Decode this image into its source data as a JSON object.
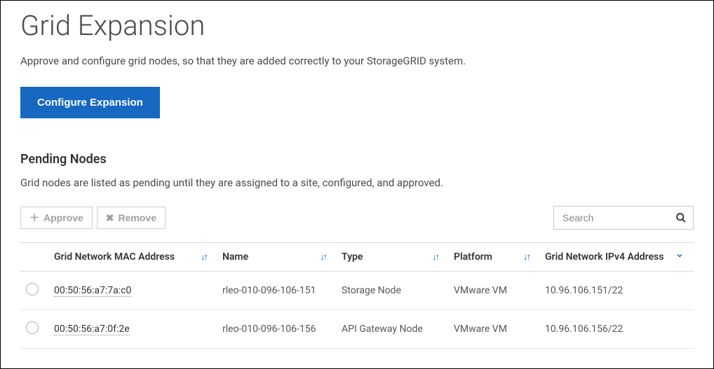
{
  "page": {
    "title": "Grid Expansion",
    "subtitle": "Approve and configure grid nodes, so that they are added correctly to your StorageGRID system.",
    "configure_button": "Configure Expansion"
  },
  "pending": {
    "title": "Pending Nodes",
    "description": "Grid nodes are listed as pending until they are assigned to a site, configured, and approved.",
    "approve_label": "Approve",
    "remove_label": "Remove",
    "search_placeholder": "Search"
  },
  "table": {
    "headers": {
      "mac": "Grid Network MAC Address",
      "name": "Name",
      "type": "Type",
      "platform": "Platform",
      "ip": "Grid Network IPv4 Address"
    },
    "rows": [
      {
        "mac": "00:50:56:a7:7a:c0",
        "name": "rleo-010-096-106-151",
        "type": "Storage Node",
        "platform": "VMware VM",
        "ip": "10.96.106.151/22"
      },
      {
        "mac": "00:50:56:a7:0f:2e",
        "name": "rleo-010-096-106-156",
        "type": "API Gateway Node",
        "platform": "VMware VM",
        "ip": "10.96.106.156/22"
      }
    ]
  }
}
